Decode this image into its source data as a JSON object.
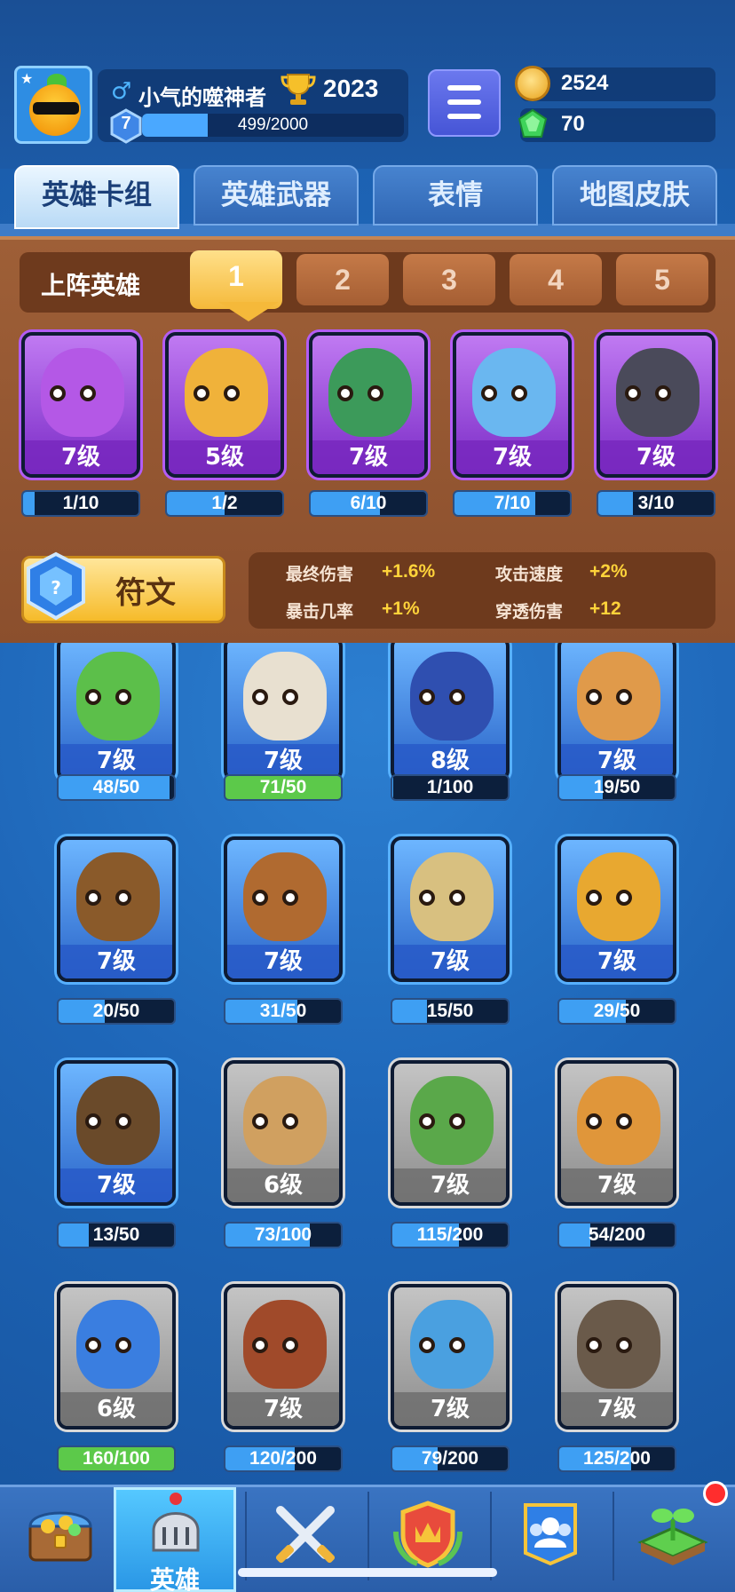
{
  "header": {
    "player_name": "小气的噬神者",
    "trophies": "2023",
    "level": "7",
    "xp_text": "499/2000",
    "xp_progress": 0.2495,
    "gold": "2524",
    "gems": "70"
  },
  "tabs": [
    {
      "label": "英雄卡组",
      "active": true
    },
    {
      "label": "英雄武器",
      "active": false
    },
    {
      "label": "表情",
      "active": false
    },
    {
      "label": "地图皮肤",
      "active": false
    }
  ],
  "lineup": {
    "label": "上阵英雄",
    "slots": [
      "1",
      "2",
      "3",
      "4",
      "5"
    ],
    "active_slot": "1",
    "heroes": [
      {
        "level": "7级",
        "progress": "1/10",
        "fraction": 0.1,
        "color": "#b458e6"
      },
      {
        "level": "5级",
        "progress": "1/2",
        "fraction": 0.5,
        "color": "#f0b23a"
      },
      {
        "level": "7级",
        "progress": "6/10",
        "fraction": 0.6,
        "color": "#3c9a5a"
      },
      {
        "level": "7级",
        "progress": "7/10",
        "fraction": 0.7,
        "color": "#6ab7f0"
      },
      {
        "level": "7级",
        "progress": "3/10",
        "fraction": 0.3,
        "color": "#4a4a5a"
      }
    ]
  },
  "rune": {
    "label": "符文",
    "stats": [
      {
        "label": "最终伤害",
        "value": "+1.6%"
      },
      {
        "label": "攻击速度",
        "value": "+2%"
      },
      {
        "label": "暴击几率",
        "value": "+1%"
      },
      {
        "label": "穿透伤害",
        "value": "+12"
      }
    ]
  },
  "collection": [
    {
      "level": "7级",
      "progress": "48/50",
      "fraction": 0.96,
      "style": "blue",
      "color": "#5cbf4a"
    },
    {
      "level": "7级",
      "progress": "71/50",
      "fraction": 1.0,
      "style": "blue",
      "color": "#e8e0d0"
    },
    {
      "level": "8级",
      "progress": "1/100",
      "fraction": 0.01,
      "style": "blue",
      "color": "#2f4fb0"
    },
    {
      "level": "7级",
      "progress": "19/50",
      "fraction": 0.38,
      "style": "blue",
      "color": "#e09a4a"
    },
    {
      "level": "7级",
      "progress": "20/50",
      "fraction": 0.4,
      "style": "blue",
      "color": "#8a5a2a"
    },
    {
      "level": "7级",
      "progress": "31/50",
      "fraction": 0.62,
      "style": "blue",
      "color": "#b06a30"
    },
    {
      "level": "7级",
      "progress": "15/50",
      "fraction": 0.3,
      "style": "blue",
      "color": "#d8c080"
    },
    {
      "level": "7级",
      "progress": "29/50",
      "fraction": 0.58,
      "style": "blue",
      "color": "#e8a830"
    },
    {
      "level": "7级",
      "progress": "13/50",
      "fraction": 0.26,
      "style": "blue",
      "color": "#6a4a2a"
    },
    {
      "level": "6级",
      "progress": "73/100",
      "fraction": 0.73,
      "style": "grey",
      "color": "#d0a060"
    },
    {
      "level": "7级",
      "progress": "115/200",
      "fraction": 0.575,
      "style": "grey",
      "color": "#5aa84a"
    },
    {
      "level": "7级",
      "progress": "54/200",
      "fraction": 0.27,
      "style": "grey",
      "color": "#e0963a"
    },
    {
      "level": "6级",
      "progress": "160/100",
      "fraction": 1.0,
      "style": "grey",
      "color": "#3a7ee0"
    },
    {
      "level": "7级",
      "progress": "120/200",
      "fraction": 0.6,
      "style": "grey",
      "color": "#a04a2a"
    },
    {
      "level": "7级",
      "progress": "79/200",
      "fraction": 0.395,
      "style": "grey",
      "color": "#4aa0e0"
    },
    {
      "level": "7级",
      "progress": "125/200",
      "fraction": 0.625,
      "style": "grey",
      "color": "#6a5a4a"
    }
  ],
  "bottom_nav": [
    {
      "icon": "treasure-chest-icon",
      "label": ""
    },
    {
      "icon": "knight-helmet-icon",
      "label": "英雄",
      "active": true
    },
    {
      "icon": "crossed-swords-icon",
      "label": ""
    },
    {
      "icon": "crown-shield-icon",
      "label": ""
    },
    {
      "icon": "friends-banner-icon",
      "label": ""
    },
    {
      "icon": "sprout-island-icon",
      "label": "",
      "notification": true
    }
  ]
}
